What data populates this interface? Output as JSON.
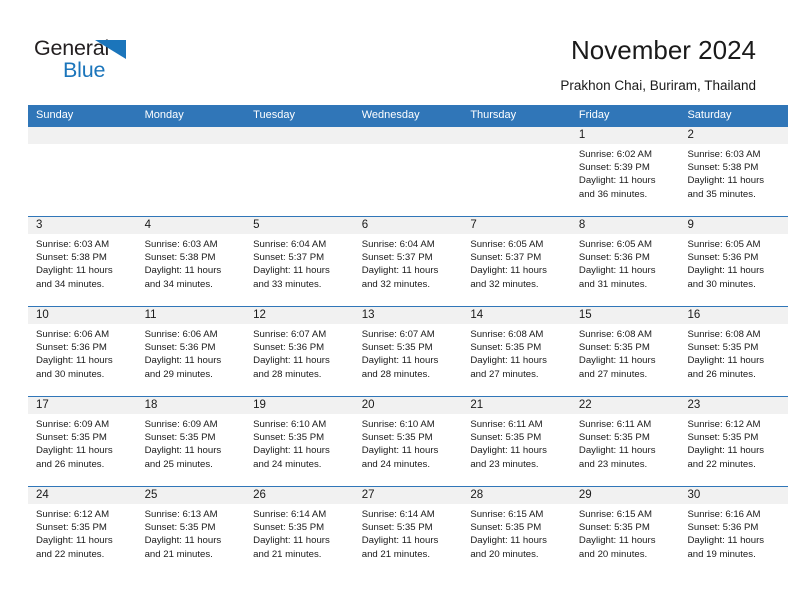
{
  "brand": {
    "name_top": "General",
    "name_bottom": "Blue",
    "triangle_color": "#1b75bb",
    "text_color": "#231f20"
  },
  "header": {
    "title": "November 2024",
    "subtitle": "Prakhon Chai, Buriram, Thailand",
    "accent_color": "#3076b8"
  },
  "calendar": {
    "weekdays": [
      "Sunday",
      "Monday",
      "Tuesday",
      "Wednesday",
      "Thursday",
      "Friday",
      "Saturday"
    ],
    "weeks": [
      [
        {
          "day": "",
          "l1": "",
          "l2": "",
          "l3": "",
          "l4": ""
        },
        {
          "day": "",
          "l1": "",
          "l2": "",
          "l3": "",
          "l4": ""
        },
        {
          "day": "",
          "l1": "",
          "l2": "",
          "l3": "",
          "l4": ""
        },
        {
          "day": "",
          "l1": "",
          "l2": "",
          "l3": "",
          "l4": ""
        },
        {
          "day": "",
          "l1": "",
          "l2": "",
          "l3": "",
          "l4": ""
        },
        {
          "day": "1",
          "l1": "Sunrise: 6:02 AM",
          "l2": "Sunset: 5:39 PM",
          "l3": "Daylight: 11 hours",
          "l4": "and 36 minutes."
        },
        {
          "day": "2",
          "l1": "Sunrise: 6:03 AM",
          "l2": "Sunset: 5:38 PM",
          "l3": "Daylight: 11 hours",
          "l4": "and 35 minutes."
        }
      ],
      [
        {
          "day": "3",
          "l1": "Sunrise: 6:03 AM",
          "l2": "Sunset: 5:38 PM",
          "l3": "Daylight: 11 hours",
          "l4": "and 34 minutes."
        },
        {
          "day": "4",
          "l1": "Sunrise: 6:03 AM",
          "l2": "Sunset: 5:38 PM",
          "l3": "Daylight: 11 hours",
          "l4": "and 34 minutes."
        },
        {
          "day": "5",
          "l1": "Sunrise: 6:04 AM",
          "l2": "Sunset: 5:37 PM",
          "l3": "Daylight: 11 hours",
          "l4": "and 33 minutes."
        },
        {
          "day": "6",
          "l1": "Sunrise: 6:04 AM",
          "l2": "Sunset: 5:37 PM",
          "l3": "Daylight: 11 hours",
          "l4": "and 32 minutes."
        },
        {
          "day": "7",
          "l1": "Sunrise: 6:05 AM",
          "l2": "Sunset: 5:37 PM",
          "l3": "Daylight: 11 hours",
          "l4": "and 32 minutes."
        },
        {
          "day": "8",
          "l1": "Sunrise: 6:05 AM",
          "l2": "Sunset: 5:36 PM",
          "l3": "Daylight: 11 hours",
          "l4": "and 31 minutes."
        },
        {
          "day": "9",
          "l1": "Sunrise: 6:05 AM",
          "l2": "Sunset: 5:36 PM",
          "l3": "Daylight: 11 hours",
          "l4": "and 30 minutes."
        }
      ],
      [
        {
          "day": "10",
          "l1": "Sunrise: 6:06 AM",
          "l2": "Sunset: 5:36 PM",
          "l3": "Daylight: 11 hours",
          "l4": "and 30 minutes."
        },
        {
          "day": "11",
          "l1": "Sunrise: 6:06 AM",
          "l2": "Sunset: 5:36 PM",
          "l3": "Daylight: 11 hours",
          "l4": "and 29 minutes."
        },
        {
          "day": "12",
          "l1": "Sunrise: 6:07 AM",
          "l2": "Sunset: 5:36 PM",
          "l3": "Daylight: 11 hours",
          "l4": "and 28 minutes."
        },
        {
          "day": "13",
          "l1": "Sunrise: 6:07 AM",
          "l2": "Sunset: 5:35 PM",
          "l3": "Daylight: 11 hours",
          "l4": "and 28 minutes."
        },
        {
          "day": "14",
          "l1": "Sunrise: 6:08 AM",
          "l2": "Sunset: 5:35 PM",
          "l3": "Daylight: 11 hours",
          "l4": "and 27 minutes."
        },
        {
          "day": "15",
          "l1": "Sunrise: 6:08 AM",
          "l2": "Sunset: 5:35 PM",
          "l3": "Daylight: 11 hours",
          "l4": "and 27 minutes."
        },
        {
          "day": "16",
          "l1": "Sunrise: 6:08 AM",
          "l2": "Sunset: 5:35 PM",
          "l3": "Daylight: 11 hours",
          "l4": "and 26 minutes."
        }
      ],
      [
        {
          "day": "17",
          "l1": "Sunrise: 6:09 AM",
          "l2": "Sunset: 5:35 PM",
          "l3": "Daylight: 11 hours",
          "l4": "and 26 minutes."
        },
        {
          "day": "18",
          "l1": "Sunrise: 6:09 AM",
          "l2": "Sunset: 5:35 PM",
          "l3": "Daylight: 11 hours",
          "l4": "and 25 minutes."
        },
        {
          "day": "19",
          "l1": "Sunrise: 6:10 AM",
          "l2": "Sunset: 5:35 PM",
          "l3": "Daylight: 11 hours",
          "l4": "and 24 minutes."
        },
        {
          "day": "20",
          "l1": "Sunrise: 6:10 AM",
          "l2": "Sunset: 5:35 PM",
          "l3": "Daylight: 11 hours",
          "l4": "and 24 minutes."
        },
        {
          "day": "21",
          "l1": "Sunrise: 6:11 AM",
          "l2": "Sunset: 5:35 PM",
          "l3": "Daylight: 11 hours",
          "l4": "and 23 minutes."
        },
        {
          "day": "22",
          "l1": "Sunrise: 6:11 AM",
          "l2": "Sunset: 5:35 PM",
          "l3": "Daylight: 11 hours",
          "l4": "and 23 minutes."
        },
        {
          "day": "23",
          "l1": "Sunrise: 6:12 AM",
          "l2": "Sunset: 5:35 PM",
          "l3": "Daylight: 11 hours",
          "l4": "and 22 minutes."
        }
      ],
      [
        {
          "day": "24",
          "l1": "Sunrise: 6:12 AM",
          "l2": "Sunset: 5:35 PM",
          "l3": "Daylight: 11 hours",
          "l4": "and 22 minutes."
        },
        {
          "day": "25",
          "l1": "Sunrise: 6:13 AM",
          "l2": "Sunset: 5:35 PM",
          "l3": "Daylight: 11 hours",
          "l4": "and 21 minutes."
        },
        {
          "day": "26",
          "l1": "Sunrise: 6:14 AM",
          "l2": "Sunset: 5:35 PM",
          "l3": "Daylight: 11 hours",
          "l4": "and 21 minutes."
        },
        {
          "day": "27",
          "l1": "Sunrise: 6:14 AM",
          "l2": "Sunset: 5:35 PM",
          "l3": "Daylight: 11 hours",
          "l4": "and 21 minutes."
        },
        {
          "day": "28",
          "l1": "Sunrise: 6:15 AM",
          "l2": "Sunset: 5:35 PM",
          "l3": "Daylight: 11 hours",
          "l4": "and 20 minutes."
        },
        {
          "day": "29",
          "l1": "Sunrise: 6:15 AM",
          "l2": "Sunset: 5:35 PM",
          "l3": "Daylight: 11 hours",
          "l4": "and 20 minutes."
        },
        {
          "day": "30",
          "l1": "Sunrise: 6:16 AM",
          "l2": "Sunset: 5:36 PM",
          "l3": "Daylight: 11 hours",
          "l4": "and 19 minutes."
        }
      ]
    ]
  }
}
